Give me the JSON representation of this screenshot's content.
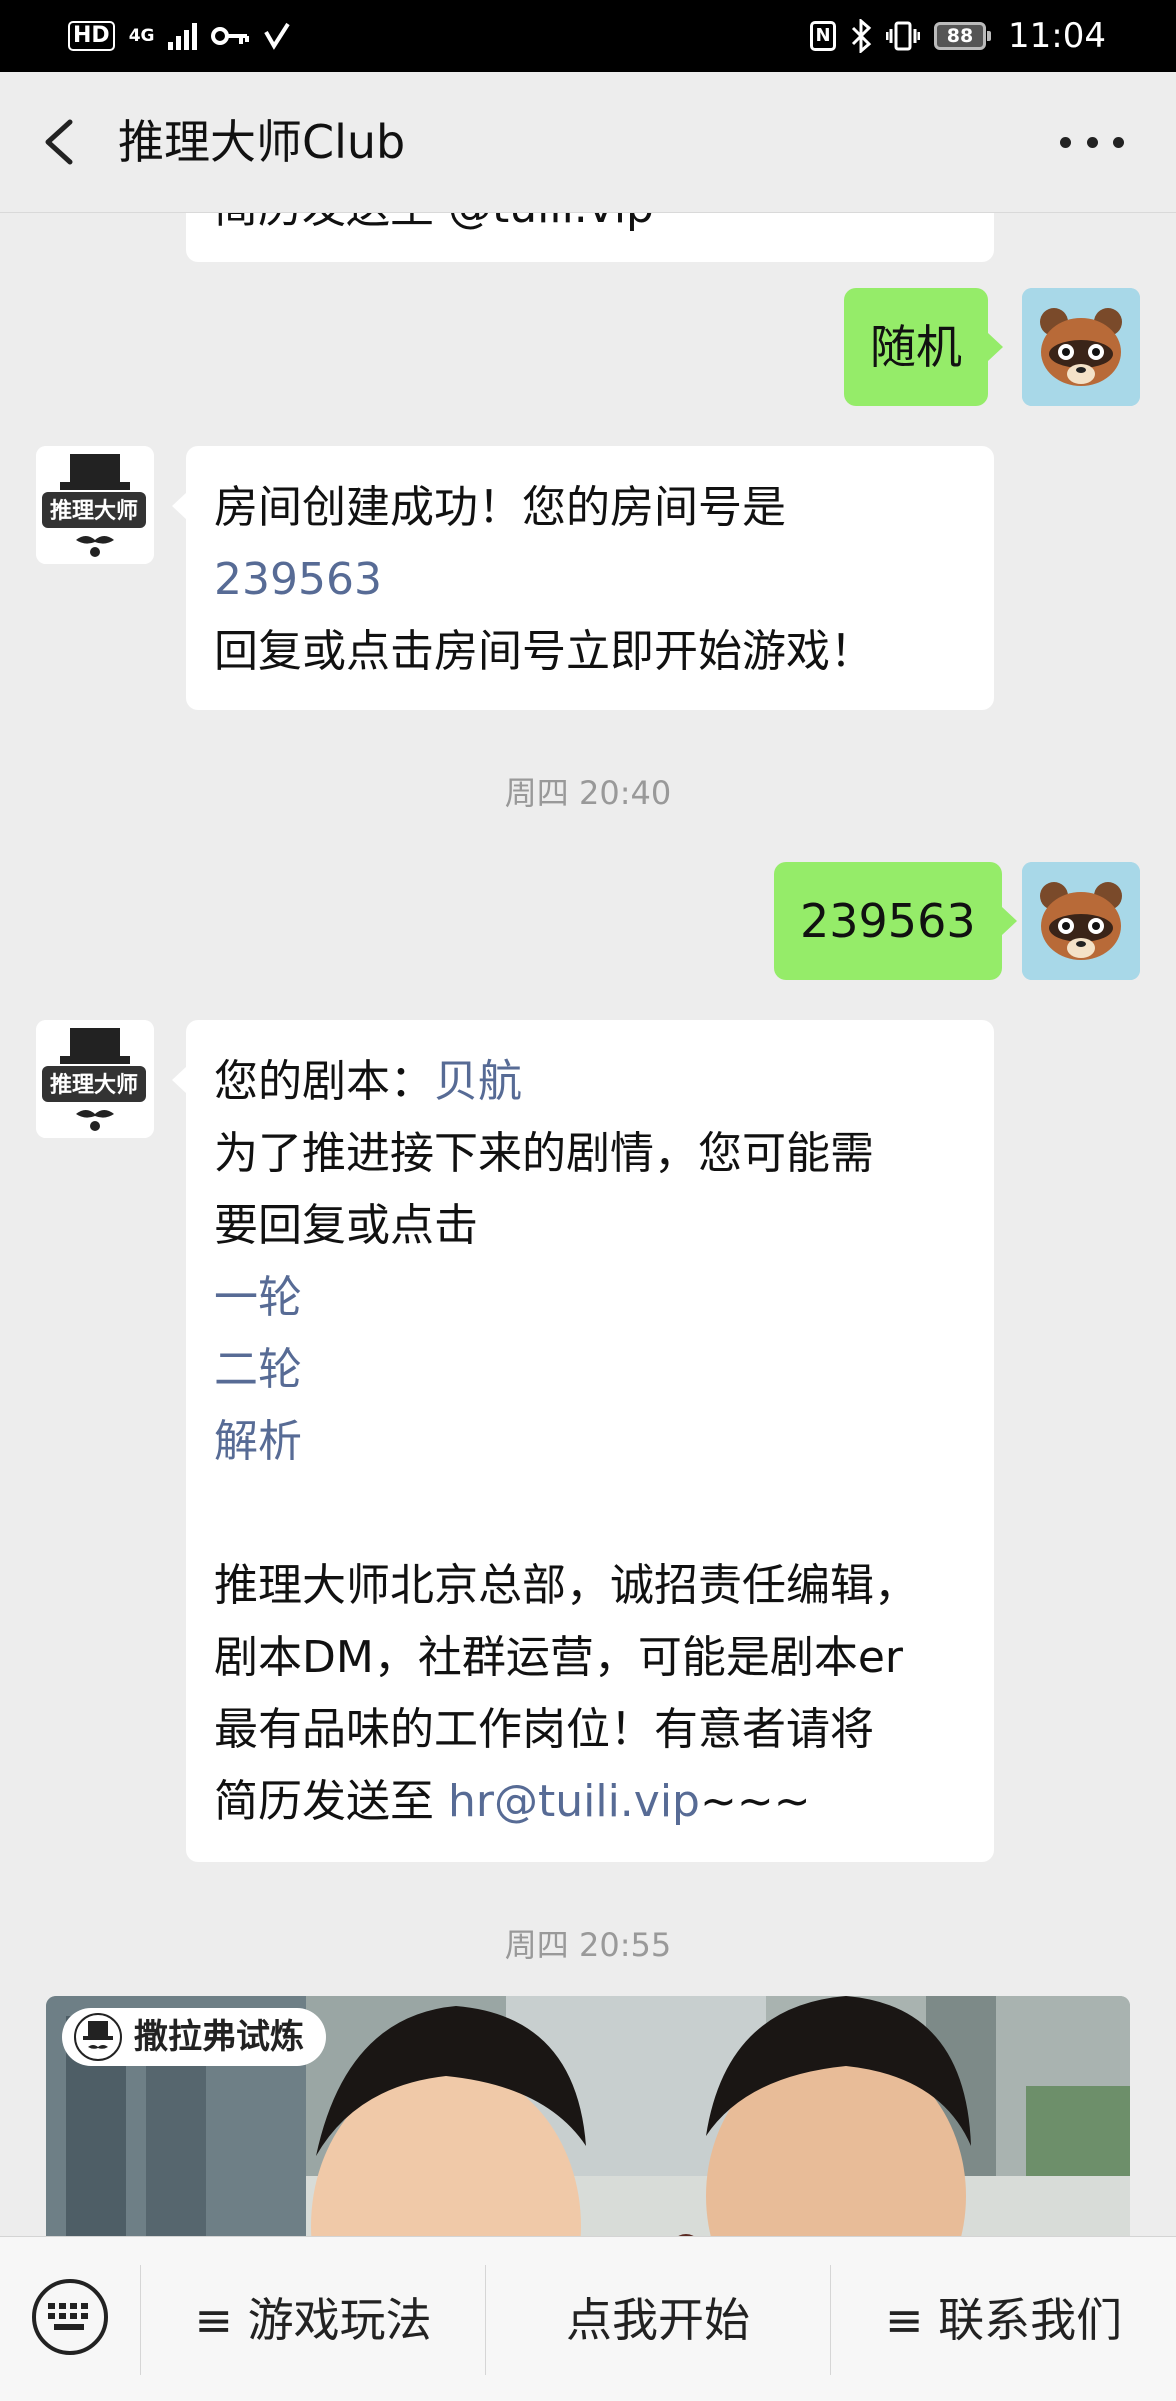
{
  "status_bar": {
    "hd": "HD",
    "network": "4G",
    "battery": "88",
    "time": "11:04"
  },
  "nav": {
    "title": "推理大师Club"
  },
  "messages": {
    "m0_clipped": "简历发送至 @tuili.vip",
    "m1_user": "随机",
    "m2_line1": "房间创建成功！您的房间号是",
    "m2_room": "239563",
    "m2_line3": "回复或点击房间号立即开始游戏！",
    "ts1": "周四 20:40",
    "m3_user": "239563",
    "m4_script_label": "您的剧本：",
    "m4_script_name": "贝航",
    "m4_line2": "为了推进接下来的剧情，您可能需",
    "m4_line3": "要回复或点击",
    "m4_opt1": "一轮",
    "m4_opt2": "二轮",
    "m4_opt3": "解析",
    "m4_p1": "推理大师北京总部，诚招责任编辑，",
    "m4_p2": "剧本DM，社群运营，可能是剧本er",
    "m4_p3": "最有品味的工作岗位！有意者请将",
    "m4_p4_pre": "简历发送至 ",
    "m4_email": "hr@tuili.vip",
    "m4_p4_post": "~~~",
    "ts2": "周四 20:55",
    "video_tag": "撒拉弗试炼"
  },
  "bottom_bar": {
    "menu1": "≡ 游戏玩法",
    "menu2": "点我开始",
    "menu3": "≡ 联系我们"
  },
  "colors": {
    "link": "#576b95",
    "sent_bubble": "#95ec69",
    "background": "#ededed"
  },
  "icons": [
    "back-arrow-icon",
    "more-dots-icon",
    "keyboard-icon",
    "bot-avatar-logo",
    "user-avatar-raccoon"
  ]
}
